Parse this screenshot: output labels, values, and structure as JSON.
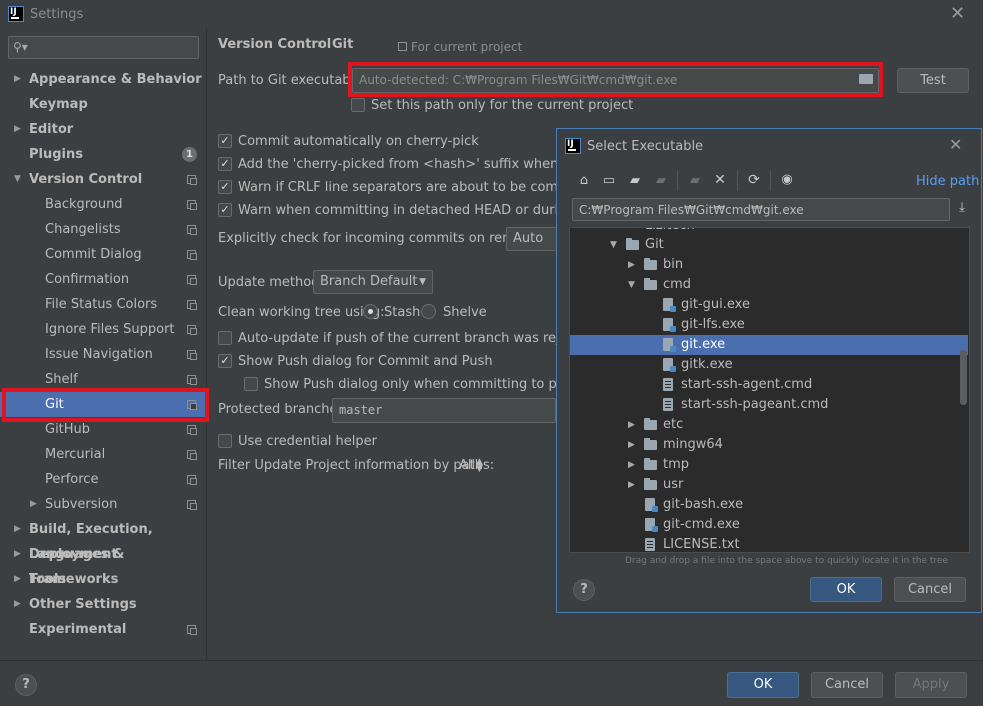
{
  "window": {
    "title": "Settings"
  },
  "search": {
    "placeholder": ""
  },
  "sidebar": {
    "items": [
      {
        "label": "Appearance & Behavior",
        "level": 0,
        "arrow": "right",
        "bold": true
      },
      {
        "label": "Keymap",
        "level": 0,
        "bold": true
      },
      {
        "label": "Editor",
        "level": 0,
        "arrow": "right",
        "bold": true
      },
      {
        "label": "Plugins",
        "level": 0,
        "bold": true,
        "badge": "1"
      },
      {
        "label": "Version Control",
        "level": 0,
        "arrow": "down",
        "bold": true,
        "copy": true
      },
      {
        "label": "Background",
        "level": 1,
        "copy": true
      },
      {
        "label": "Changelists",
        "level": 1,
        "copy": true
      },
      {
        "label": "Commit Dialog",
        "level": 1,
        "copy": true
      },
      {
        "label": "Confirmation",
        "level": 1,
        "copy": true
      },
      {
        "label": "File Status Colors",
        "level": 1,
        "copy": true
      },
      {
        "label": "Ignore Files Support",
        "level": 1,
        "copy": true
      },
      {
        "label": "Issue Navigation",
        "level": 1,
        "copy": true
      },
      {
        "label": "Shelf",
        "level": 1,
        "copy": true
      },
      {
        "label": "Git",
        "level": 1,
        "copy": true,
        "selected": true
      },
      {
        "label": "GitHub",
        "level": 1,
        "copy": true
      },
      {
        "label": "Mercurial",
        "level": 1,
        "copy": true
      },
      {
        "label": "Perforce",
        "level": 1,
        "copy": true
      },
      {
        "label": "Subversion",
        "level": 1,
        "arrow": "right",
        "copy": true
      },
      {
        "label": "Build, Execution, Deployment",
        "level": 0,
        "arrow": "right",
        "bold": true
      },
      {
        "label": "Languages & Frameworks",
        "level": 0,
        "arrow": "right",
        "bold": true
      },
      {
        "label": "Tools",
        "level": 0,
        "arrow": "right",
        "bold": true
      },
      {
        "label": "Other Settings",
        "level": 0,
        "arrow": "right",
        "bold": true
      },
      {
        "label": "Experimental",
        "level": 0,
        "bold": true,
        "copy": true
      }
    ]
  },
  "main": {
    "breadcrumb": {
      "parent": "Version Control",
      "sep": "›",
      "current": "Git"
    },
    "scope": "For current project",
    "path_label": "Path to Git executable:",
    "path_placeholder": "Auto-detected: C:₩Program Files₩Git₩cmd₩git.exe",
    "test_button": "Test",
    "set_path_only": "Set this path only for the current project",
    "options": [
      {
        "label": "Commit automatically on cherry-pick",
        "checked": true
      },
      {
        "label": "Add the 'cherry-picked from <hash>' suffix when picking c",
        "checked": true
      },
      {
        "label": "Warn if CRLF line separators are about to be committed",
        "checked": true
      },
      {
        "label": "Warn when committing in detached HEAD or during rebas",
        "checked": true
      }
    ],
    "incoming_label": "Explicitly check for incoming commits on remotes:",
    "incoming_value": "Auto",
    "update_method_label": "Update method:",
    "update_method_value": "Branch Default",
    "clean_tree_label": "Clean working tree using:",
    "stash_label": "Stash",
    "shelve_label": "Shelve",
    "auto_update_label": "Auto-update if push of the current branch was rejected",
    "show_push_label": "Show Push dialog for Commit and Push",
    "show_push_protected_label": "Show Push dialog only when committing to protected",
    "protected_label": "Protected branches:",
    "protected_value": "master",
    "credential_label": "Use credential helper",
    "filter_label": "Filter Update Project information by paths:",
    "filter_value": "All"
  },
  "footer": {
    "help": "?",
    "ok": "OK",
    "cancel": "Cancel",
    "apply": "Apply"
  },
  "dialog": {
    "title": "Select Executable",
    "hide_path": "Hide path",
    "path_value": "C:₩Program Files₩Git₩cmd₩git.exe",
    "partial_top": "Lizitech",
    "tree": [
      {
        "name": "Git",
        "indent": 0,
        "arrow": "down",
        "kind": "folder"
      },
      {
        "name": "bin",
        "indent": 1,
        "arrow": "right",
        "kind": "folder"
      },
      {
        "name": "cmd",
        "indent": 1,
        "arrow": "down",
        "kind": "folder"
      },
      {
        "name": "git-gui.exe",
        "indent": 2,
        "kind": "exe"
      },
      {
        "name": "git-lfs.exe",
        "indent": 2,
        "kind": "exe"
      },
      {
        "name": "git.exe",
        "indent": 2,
        "kind": "exe",
        "selected": true
      },
      {
        "name": "gitk.exe",
        "indent": 2,
        "kind": "exe"
      },
      {
        "name": "start-ssh-agent.cmd",
        "indent": 2,
        "kind": "doc"
      },
      {
        "name": "start-ssh-pageant.cmd",
        "indent": 2,
        "kind": "doc"
      },
      {
        "name": "etc",
        "indent": 1,
        "arrow": "right",
        "kind": "folder"
      },
      {
        "name": "mingw64",
        "indent": 1,
        "arrow": "right",
        "kind": "folder"
      },
      {
        "name": "tmp",
        "indent": 1,
        "arrow": "right",
        "kind": "folder"
      },
      {
        "name": "usr",
        "indent": 1,
        "arrow": "right",
        "kind": "folder"
      },
      {
        "name": "git-bash.exe",
        "indent": 1,
        "kind": "exe"
      },
      {
        "name": "git-cmd.exe",
        "indent": 1,
        "kind": "exe"
      },
      {
        "name": "LICENSE.txt",
        "indent": 1,
        "kind": "doc"
      }
    ],
    "hint": "Drag and drop a file into the space above to quickly locate it in the tree",
    "ok": "OK",
    "cancel": "Cancel",
    "help": "?"
  }
}
